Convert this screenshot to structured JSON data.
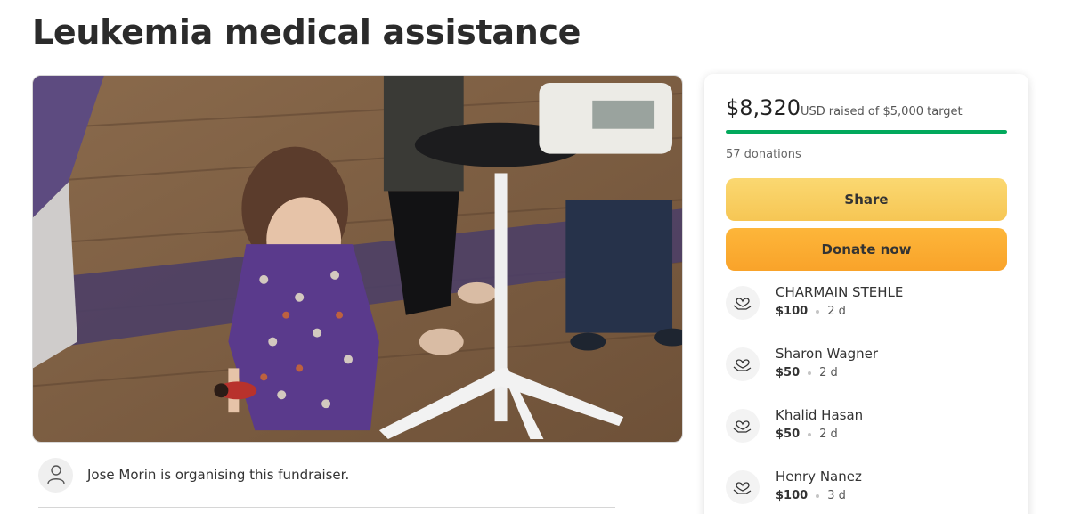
{
  "page": {
    "title": "Leukemia medical assistance"
  },
  "organiser": {
    "text": "Jose Morin is organising this fundraiser."
  },
  "summary": {
    "amount": "$8,320",
    "currency": "USD",
    "raised_text": "raised of $5,000 target",
    "progress_fraction": 1.0,
    "donations_count": "57 donations"
  },
  "buttons": {
    "share": "Share",
    "donate": "Donate now"
  },
  "donors": [
    {
      "name": "CHARMAIN STEHLE",
      "amount": "$100",
      "time": "2 d"
    },
    {
      "name": "Sharon Wagner",
      "amount": "$50",
      "time": "2 d"
    },
    {
      "name": "Khalid Hasan",
      "amount": "$50",
      "time": "2 d"
    },
    {
      "name": "Henry Nanez",
      "amount": "$100",
      "time": "3 d"
    }
  ],
  "colors": {
    "progress": "#02a95c",
    "share_button": "#f6c654",
    "donate_button": "#f9a32a"
  }
}
